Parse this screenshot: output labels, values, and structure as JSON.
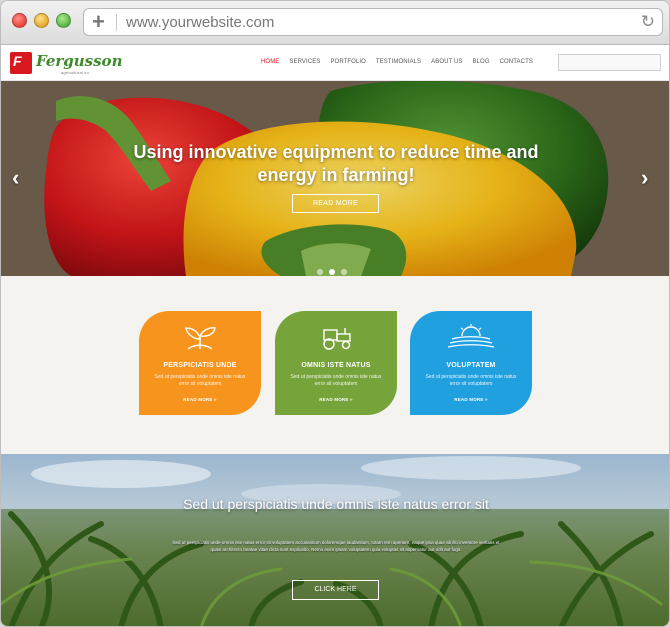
{
  "browser": {
    "url": "www.yourwebsite.com"
  },
  "site": {
    "brand": "Fergusson",
    "tagline": "agricultural co.",
    "nav": [
      "HOME",
      "SERVICES",
      "PORTFOLIO",
      "TESTIMONIALS",
      "ABOUT US",
      "BLOG",
      "CONTACTS"
    ],
    "nav_active": "HOME",
    "accent": "#d8181f"
  },
  "hero": {
    "title": "Using innovative equipment to reduce time and energy in farming!",
    "button": "READ MORE",
    "prev_icon": "chevron-left-icon",
    "next_icon": "chevron-right-icon",
    "slides": 3,
    "active_slide": 1
  },
  "services": [
    {
      "title": "PERSPICIATIS UNDE",
      "text": "Sed ut perspiciatis unde omnis iste natus error sit voluptatem",
      "more": "READ MORE »",
      "icon": "sprout-icon",
      "color": "#f7941d"
    },
    {
      "title": "OMNIS ISTE NATUS",
      "text": "Sed ut perspiciatis unde omnis iste natus error sit voluptatem",
      "more": "READ MORE »",
      "icon": "tractor-icon",
      "color": "#76a33a"
    },
    {
      "title": "VOLUPTATEM",
      "text": "Sed ut perspiciatis unde omnis iste natus error sit voluptatem",
      "more": "READ MORE »",
      "icon": "sunrise-field-icon",
      "color": "#21a0e0"
    }
  ],
  "banner": {
    "title": "Sed ut perspiciatis unde omnis iste natus error sit",
    "text": "Sed ut perspiciatis unde omnis iste natus error sit voluptatem accusantium doloremque laudantium, totam rem aperiam, eaque ipsa quae ab illo inventore veritatis et quasi architecto beatae vitae dicta sunt explicabo. Nemo enim ipsam voluptatem quia voluptas sit aspernatur aut odit aut fugit.",
    "button": "CLICK HERE"
  }
}
